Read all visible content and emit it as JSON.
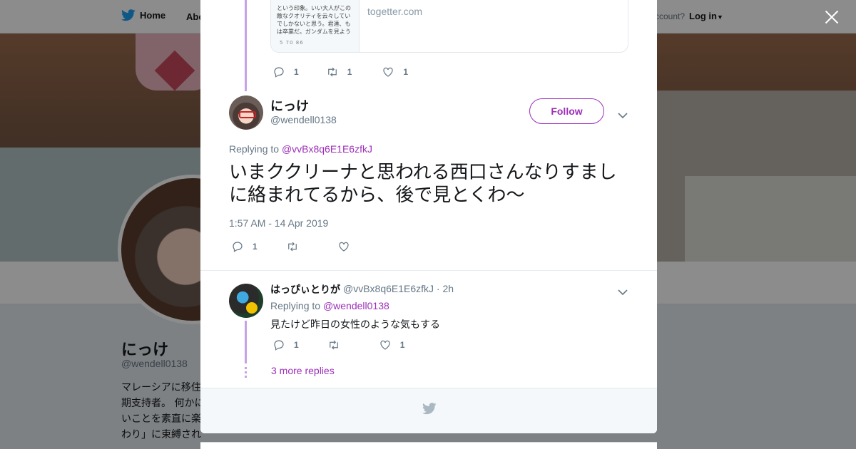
{
  "nav": {
    "home_label": "Home",
    "about_label": "Abo",
    "account_prompt": "ccount?",
    "login_label": "Log in"
  },
  "background_profile": {
    "name": "にっけ",
    "handle": "@wendell0138",
    "bio": "マレーシアに移住 期支持者。 何かに いことを素直に楽 わり」に束縛され"
  },
  "quoted_card": {
    "thumb_text": "という印象。いい大人がこの 敵なクオリティを云々してい でしかないと思う。君達、も は卒業だ。ガンダムを見よう",
    "thumb_stats": "5   70   86",
    "domain": "togetter.com"
  },
  "prev_tweet_actions": {
    "replies": "1",
    "retweets": "1",
    "likes": "1"
  },
  "main_tweet": {
    "name": "にっけ",
    "handle": "@wendell0138",
    "follow_label": "Follow",
    "replying_to_label": "Replying to",
    "replying_to_handle": "@vvBx8q6E1E6zfkJ",
    "text": "いまククリーナと思われる西口さんなりすましに絡まれてるから、後で見とくわ〜",
    "timestamp": "1:57 AM - 14 Apr 2019",
    "replies": "1",
    "retweets": "",
    "likes": ""
  },
  "reply_tweet": {
    "name": "はっぴぃとりが",
    "meta": "@vvBx8q6E1E6zfkJ · 2h",
    "replying_to_label": "Replying to",
    "replying_to_handle": "@wendell0138",
    "text": "見たけど昨日の女性のような気もする",
    "replies": "1",
    "retweets": "",
    "likes": "1"
  },
  "more_replies_label": "3 more replies",
  "colors": {
    "accent": "#9d2fb9",
    "thread_line": "#c5a1e6",
    "twitter_blue": "#1da1f2"
  },
  "icons": [
    "twitter-bird-icon",
    "close-icon",
    "reply-icon",
    "retweet-icon",
    "like-icon",
    "chevron-down-icon"
  ]
}
